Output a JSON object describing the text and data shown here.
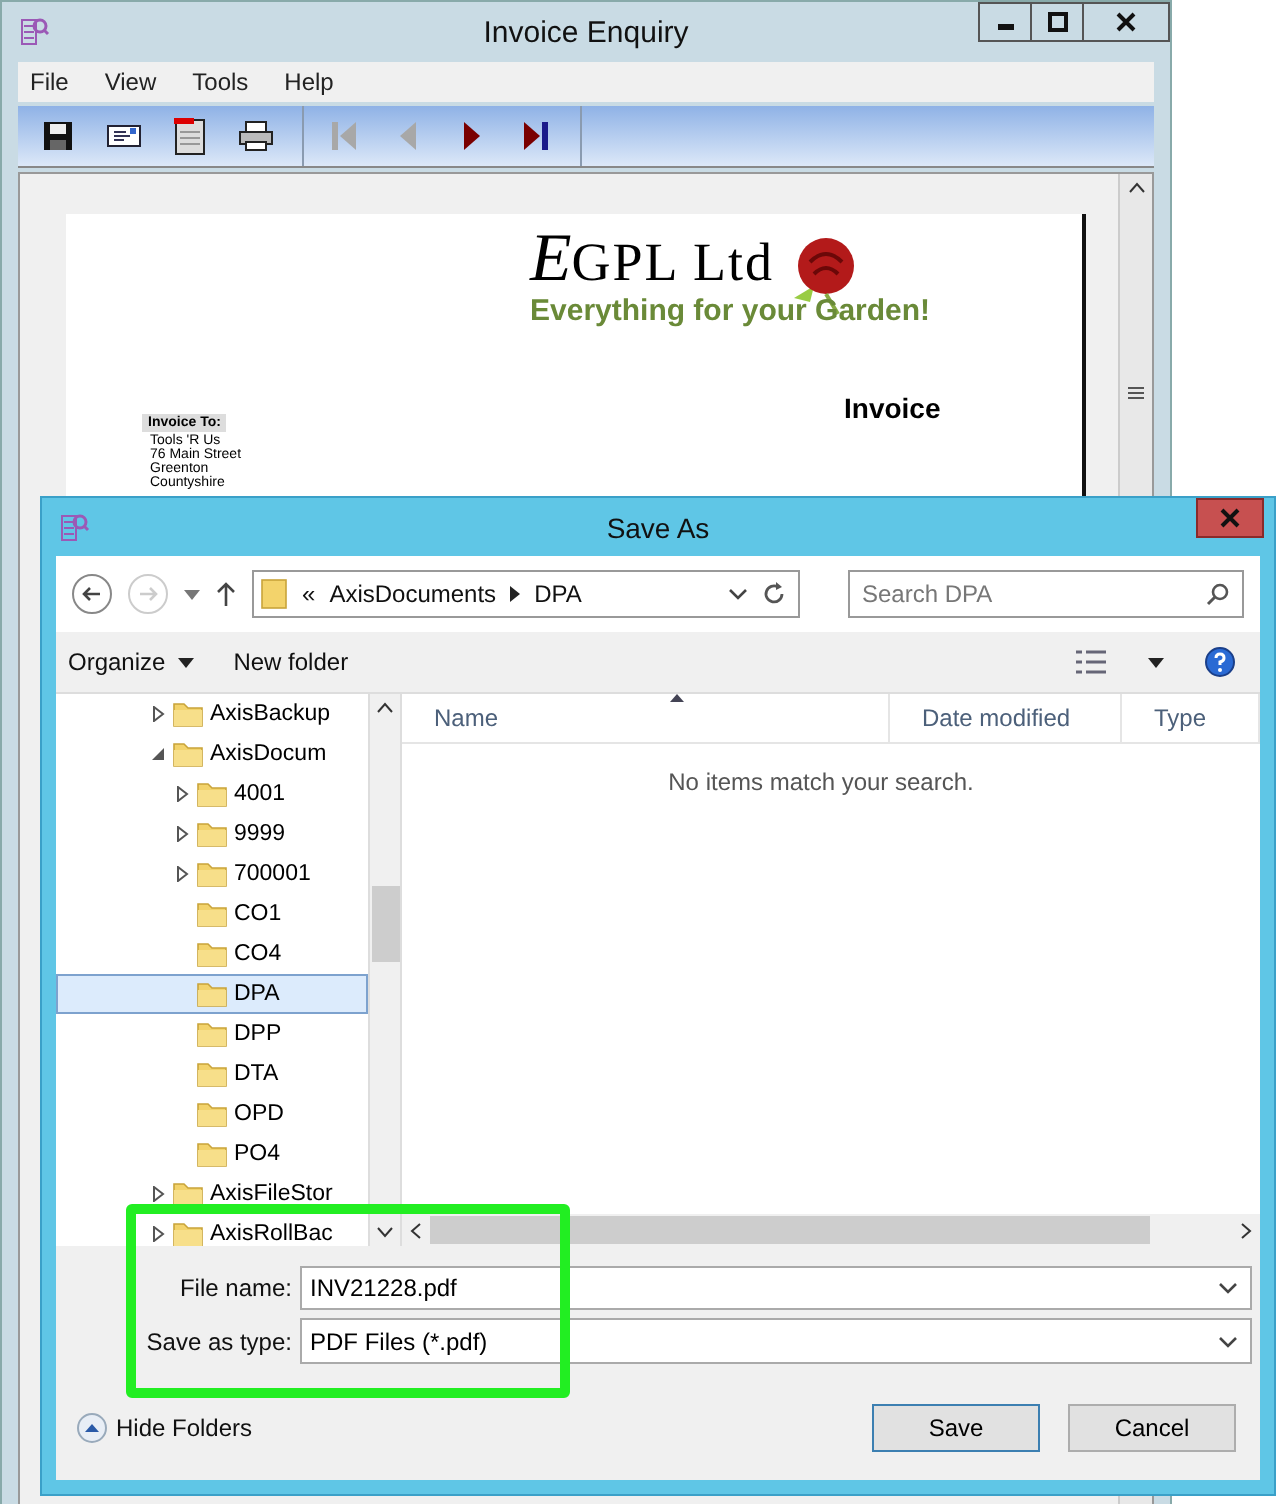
{
  "main_window": {
    "title": "Invoice Enquiry",
    "menu": [
      "File",
      "View",
      "Tools",
      "Help"
    ],
    "toolbar": [
      {
        "kind": "save"
      },
      {
        "kind": "email"
      },
      {
        "kind": "pdf"
      },
      {
        "kind": "print"
      }
    ],
    "navigation": [
      {
        "kind": "first",
        "disabled": true
      },
      {
        "kind": "previous",
        "disabled": true
      },
      {
        "kind": "next",
        "disabled": false
      },
      {
        "kind": "last",
        "disabled": false
      }
    ],
    "document": {
      "company": "GPL Ltd",
      "company_initial": "E",
      "tagline": "Everything for your Garden!",
      "heading": "Invoice",
      "invoice_to_label": "Invoice To:",
      "address": [
        "Tools 'R Us",
        "76 Main Street",
        "Greenton",
        "Countyshire"
      ]
    }
  },
  "dialog": {
    "title": "Save As",
    "breadcrumb": [
      "«",
      "AxisDocuments",
      "DPA"
    ],
    "search": {
      "placeholder": "Search DPA"
    },
    "commands": [
      "Organize",
      "New folder"
    ],
    "tree": [
      {
        "label": "AxisBackup",
        "expanded": false,
        "selected": false
      },
      {
        "label": "AxisDocum",
        "expanded": true,
        "selected": false,
        "children": [
          {
            "label": "4001",
            "expanded": false,
            "selected": false
          },
          {
            "label": "9999",
            "expanded": false,
            "selected": false
          },
          {
            "label": "700001",
            "expanded": false,
            "selected": false
          },
          {
            "label": "CO1",
            "selected": false
          },
          {
            "label": "CO4",
            "selected": false
          },
          {
            "label": "DPA",
            "selected": true
          },
          {
            "label": "DPP",
            "selected": false
          },
          {
            "label": "DTA",
            "selected": false
          },
          {
            "label": "OPD",
            "selected": false
          },
          {
            "label": "PO4",
            "selected": false
          }
        ]
      },
      {
        "label": "AxisFileStor",
        "expanded": false,
        "selected": false
      },
      {
        "label": "AxisRollBac",
        "expanded": false,
        "selected": false
      }
    ],
    "columns": [
      "Name",
      "Date modified",
      "Type"
    ],
    "empty_message": "No items match your search.",
    "file_name": {
      "label": "File name:",
      "value": "INV21228.pdf"
    },
    "save_as_type": {
      "label": "Save as type:",
      "value": "PDF Files (*.pdf)"
    },
    "hide_folders": "Hide Folders",
    "buttons": [
      "Save",
      "Cancel"
    ]
  }
}
